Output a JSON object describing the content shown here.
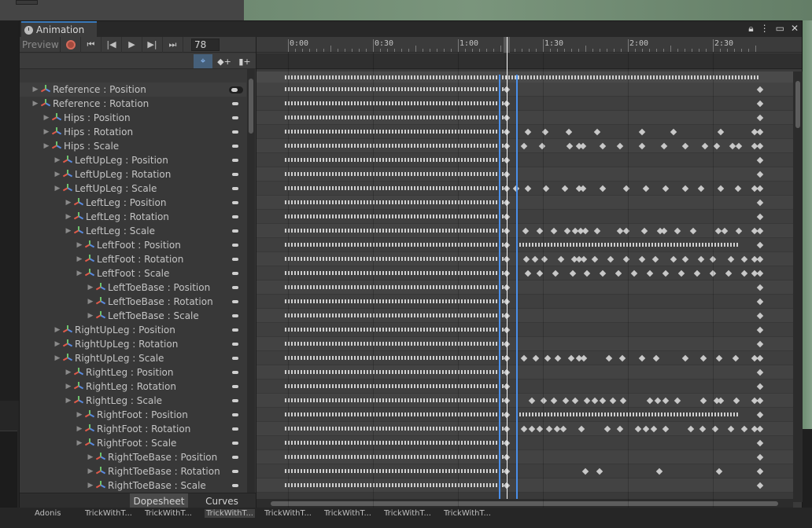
{
  "window": {
    "tab_label": "Animation"
  },
  "toolbar": {
    "preview_label": "Preview",
    "frame_value": "78"
  },
  "ruler": {
    "labels": [
      "0:00",
      "0:30",
      "1:00",
      "1:30",
      "2:00",
      "2:30"
    ]
  },
  "properties": [
    {
      "label": "Reference : Position",
      "level": 0
    },
    {
      "label": "Reference : Rotation",
      "level": 0
    },
    {
      "label": "Hips : Position",
      "level": 1
    },
    {
      "label": "Hips : Rotation",
      "level": 1
    },
    {
      "label": "Hips : Scale",
      "level": 1
    },
    {
      "label": "LeftUpLeg : Position",
      "level": 2
    },
    {
      "label": "LeftUpLeg : Rotation",
      "level": 2
    },
    {
      "label": "LeftUpLeg : Scale",
      "level": 2
    },
    {
      "label": "LeftLeg : Position",
      "level": 3
    },
    {
      "label": "LeftLeg : Rotation",
      "level": 3
    },
    {
      "label": "LeftLeg : Scale",
      "level": 3
    },
    {
      "label": "LeftFoot : Position",
      "level": 4
    },
    {
      "label": "LeftFoot : Rotation",
      "level": 4
    },
    {
      "label": "LeftFoot : Scale",
      "level": 4
    },
    {
      "label": "LeftToeBase : Position",
      "level": 5
    },
    {
      "label": "LeftToeBase : Rotation",
      "level": 5
    },
    {
      "label": "LeftToeBase : Scale",
      "level": 5
    },
    {
      "label": "RightUpLeg : Position",
      "level": 2
    },
    {
      "label": "RightUpLeg : Rotation",
      "level": 2
    },
    {
      "label": "RightUpLeg : Scale",
      "level": 2
    },
    {
      "label": "RightLeg : Position",
      "level": 3
    },
    {
      "label": "RightLeg : Rotation",
      "level": 3
    },
    {
      "label": "RightLeg : Scale",
      "level": 3
    },
    {
      "label": "RightFoot : Position",
      "level": 4
    },
    {
      "label": "RightFoot : Rotation",
      "level": 4
    },
    {
      "label": "RightFoot : Scale",
      "level": 4
    },
    {
      "label": "RightToeBase : Position",
      "level": 5
    },
    {
      "label": "RightToeBase : Rotation",
      "level": 5
    },
    {
      "label": "RightToeBase : Scale",
      "level": 5
    }
  ],
  "bottom_tabs": {
    "dopesheet": "Dopesheet",
    "curves": "Curves"
  },
  "clips": [
    "Adonis",
    "TrickWithT...",
    "TrickWithT...",
    "TrickWithT...",
    "TrickWithT...",
    "TrickWithT...",
    "TrickWithT...",
    "TrickWithT..."
  ],
  "active_clip_index": 3,
  "colors": {
    "accent": "#3a79bb",
    "selection": "#4a8ee8",
    "record": "#d46a5a"
  }
}
